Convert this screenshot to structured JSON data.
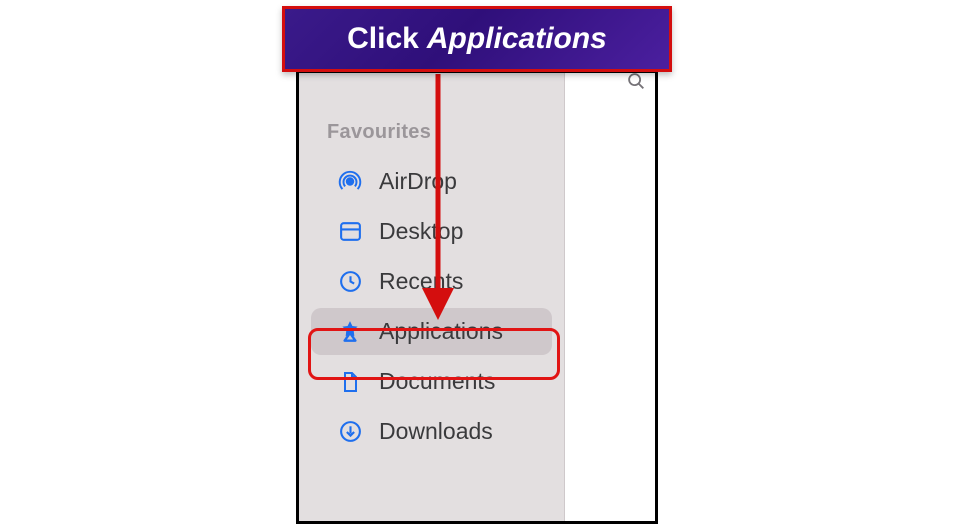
{
  "callout": {
    "prefix": "Click",
    "target": "Applications"
  },
  "sidebar": {
    "section_title": "Favourites",
    "items": [
      {
        "label": "AirDrop",
        "icon": "airdrop",
        "selected": false
      },
      {
        "label": "Desktop",
        "icon": "desktop",
        "selected": false
      },
      {
        "label": "Recents",
        "icon": "recents",
        "selected": false
      },
      {
        "label": "Applications",
        "icon": "applications",
        "selected": true
      },
      {
        "label": "Documents",
        "icon": "documents",
        "selected": false
      },
      {
        "label": "Downloads",
        "icon": "downloads",
        "selected": false
      }
    ]
  },
  "highlight": {
    "item_index": 3
  },
  "colors": {
    "sidebar_bg": "#e3dfe0",
    "icon_blue": "#1f6fee",
    "callout_border": "#d40e0e",
    "highlight_border": "#e11414"
  }
}
